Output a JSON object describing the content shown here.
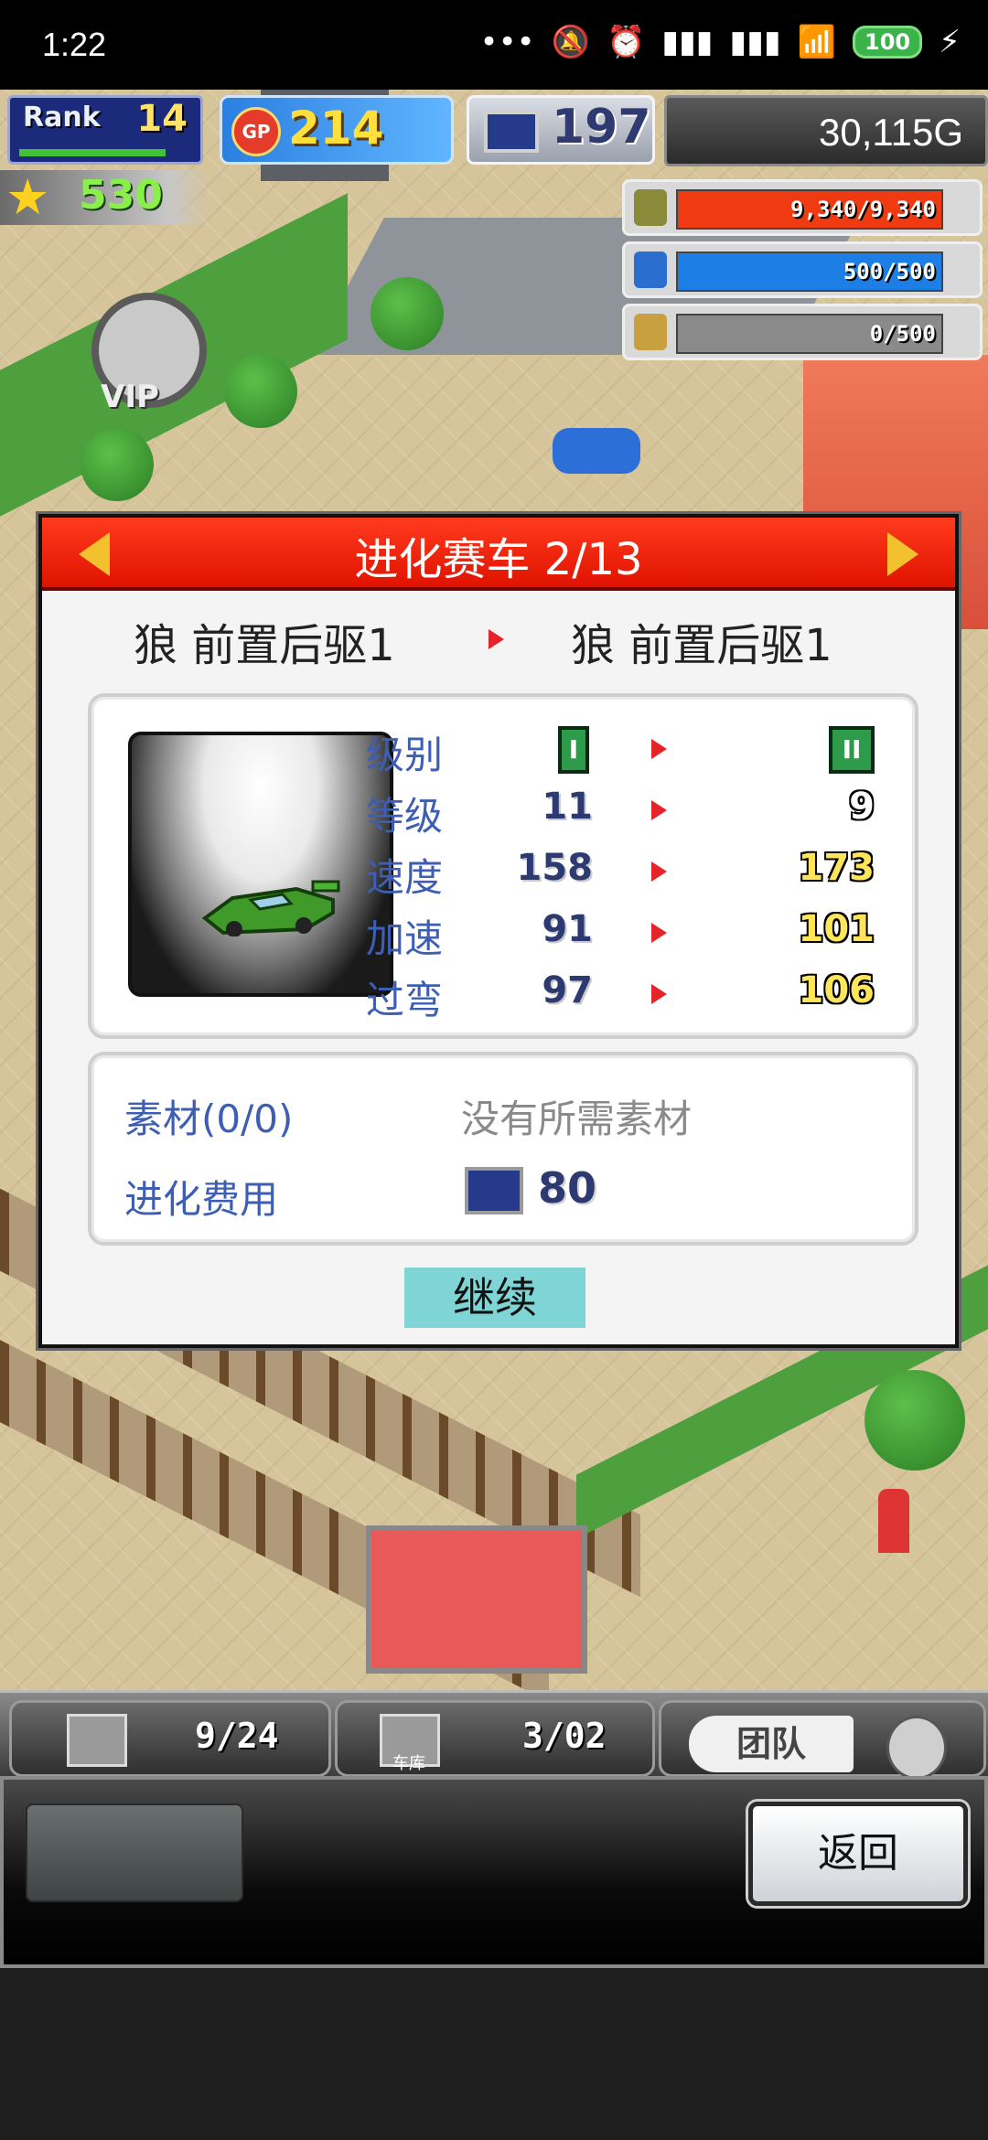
{
  "status_bar": {
    "time": "1:22",
    "battery": "100",
    "icons": [
      "more-icon",
      "mute-icon",
      "alarm-icon",
      "signal-hd-icon",
      "signal-hd-icon",
      "wifi-icon",
      "battery-icon",
      "charging-icon"
    ]
  },
  "hud": {
    "rank_label": "Rank",
    "rank_value": "14",
    "gp_label": "GP",
    "gp_value": "214",
    "research_value": "197",
    "money": "30,115G",
    "stars": "530",
    "resources": [
      {
        "name": "fuel",
        "text": "9,340/9,340",
        "fill": 1.0,
        "color": "#f03a12"
      },
      {
        "name": "oil",
        "text": "500/500",
        "fill": 1.0,
        "color": "#1d7fe6"
      },
      {
        "name": "wheat",
        "text": "0/500",
        "fill": 0.0,
        "color": "#9a9a9a"
      }
    ],
    "vip_label": "VIP"
  },
  "dialog": {
    "title": "进化赛车 2/13",
    "from_name": "狼 前置后驱1",
    "to_name": "狼 前置后驱1",
    "stats": [
      {
        "label": "级别",
        "from": "I",
        "to": "II"
      },
      {
        "label": "等级",
        "from": "11",
        "to": "9"
      },
      {
        "label": "速度",
        "from": "158",
        "to": "173"
      },
      {
        "label": "加速",
        "from": "91",
        "to": "101"
      },
      {
        "label": "过弯",
        "from": "97",
        "to": "106"
      }
    ],
    "materials_label": "素材(0/0)",
    "materials_none": "没有所需素材",
    "cost_label": "进化费用",
    "cost_value": "80",
    "continue_label": "继续"
  },
  "bottom": {
    "tab1_count": "9/24",
    "tab2_label": "车库",
    "tab2_count": "3/02",
    "team_label": "团队",
    "back_label": "返回"
  }
}
